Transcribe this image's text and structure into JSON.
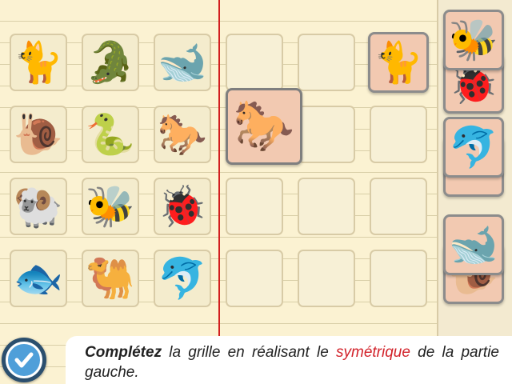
{
  "grid": {
    "left_half": [
      {
        "animal": "cat",
        "glyph": "🐈"
      },
      {
        "animal": "crocodile",
        "glyph": "🐊"
      },
      {
        "animal": "whale",
        "glyph": "🐋"
      },
      {
        "animal": "snail",
        "glyph": "🐌"
      },
      {
        "animal": "snake",
        "glyph": "🐍"
      },
      {
        "animal": "horse",
        "glyph": "🐎"
      },
      {
        "animal": "ram",
        "glyph": "🐏"
      },
      {
        "animal": "bee",
        "glyph": "🐝"
      },
      {
        "animal": "ladybug",
        "glyph": "🐞"
      },
      {
        "animal": "fish",
        "glyph": "🐟"
      },
      {
        "animal": "camel",
        "glyph": "🐫"
      },
      {
        "animal": "dolphin",
        "glyph": "🐬"
      }
    ],
    "placed_tiles": [
      {
        "animal": "cat",
        "glyph": "🐈"
      },
      {
        "animal": "horse",
        "glyph": "🐎"
      }
    ]
  },
  "tray": [
    {
      "animal": "ladybug",
      "glyph": "🐞"
    },
    {
      "animal": "bee",
      "glyph": "🐝"
    },
    {
      "animal": "dolphin",
      "glyph": "🐬"
    },
    {
      "animal": "snail",
      "glyph": "🐌"
    },
    {
      "animal": "whale",
      "glyph": "🐋"
    }
  ],
  "instruction": {
    "bold": "Complétez",
    "part1": " la grille en réalisant le ",
    "highlight": "symétrique",
    "part2": " de la partie gauche."
  },
  "colors": {
    "margin_line": "#d21f1f",
    "accent_text": "#d2222a",
    "tile_bg": "#f2c9b1",
    "validate_button": "#4f9fd9"
  },
  "icons": {
    "validate": "checkmark-icon"
  }
}
